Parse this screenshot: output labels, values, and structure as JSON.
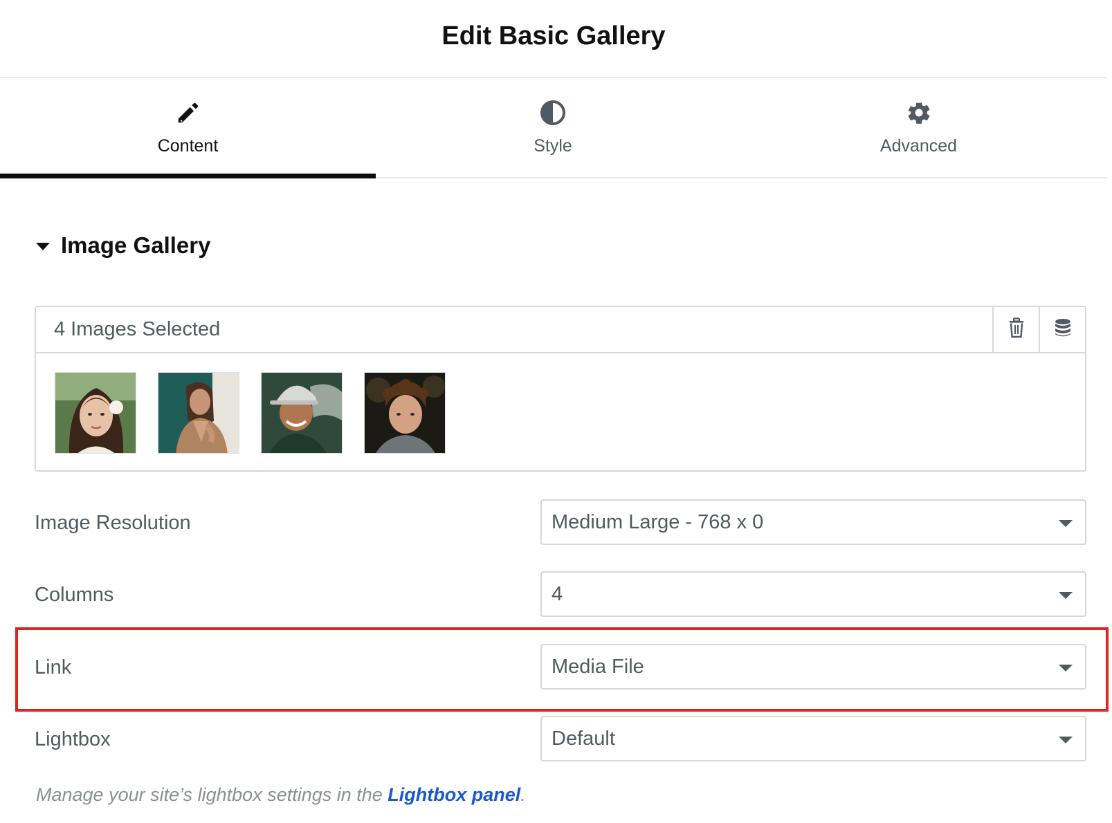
{
  "header": {
    "title": "Edit Basic Gallery"
  },
  "tabs": [
    {
      "label": "Content",
      "icon": "pencil-icon",
      "active": true
    },
    {
      "label": "Style",
      "icon": "half-circle-icon",
      "active": false
    },
    {
      "label": "Advanced",
      "icon": "gear-icon",
      "active": false
    }
  ],
  "section": {
    "title": "Image Gallery",
    "icon": "caret-down-icon"
  },
  "gallery": {
    "count_label": "4 Images Selected",
    "icons": [
      "trash-icon",
      "database-icon"
    ],
    "thumbnails": [
      "woman-with-flower",
      "woman-in-tan-jacket",
      "man-in-cap",
      "curly-haired-man"
    ]
  },
  "controls": {
    "image_resolution": {
      "label": "Image Resolution",
      "value": "Medium Large - 768 x 0"
    },
    "columns": {
      "label": "Columns",
      "value": "4"
    },
    "link": {
      "label": "Link",
      "value": "Media File"
    },
    "lightbox": {
      "label": "Lightbox",
      "value": "Default"
    }
  },
  "note": {
    "prefix": "Manage your site’s lightbox settings in the ",
    "link_text": "Lightbox panel",
    "suffix": "."
  },
  "colors": {
    "highlight": "#e02424",
    "link": "#1a57cf",
    "active_tab_bar": "#0c0d0e"
  }
}
